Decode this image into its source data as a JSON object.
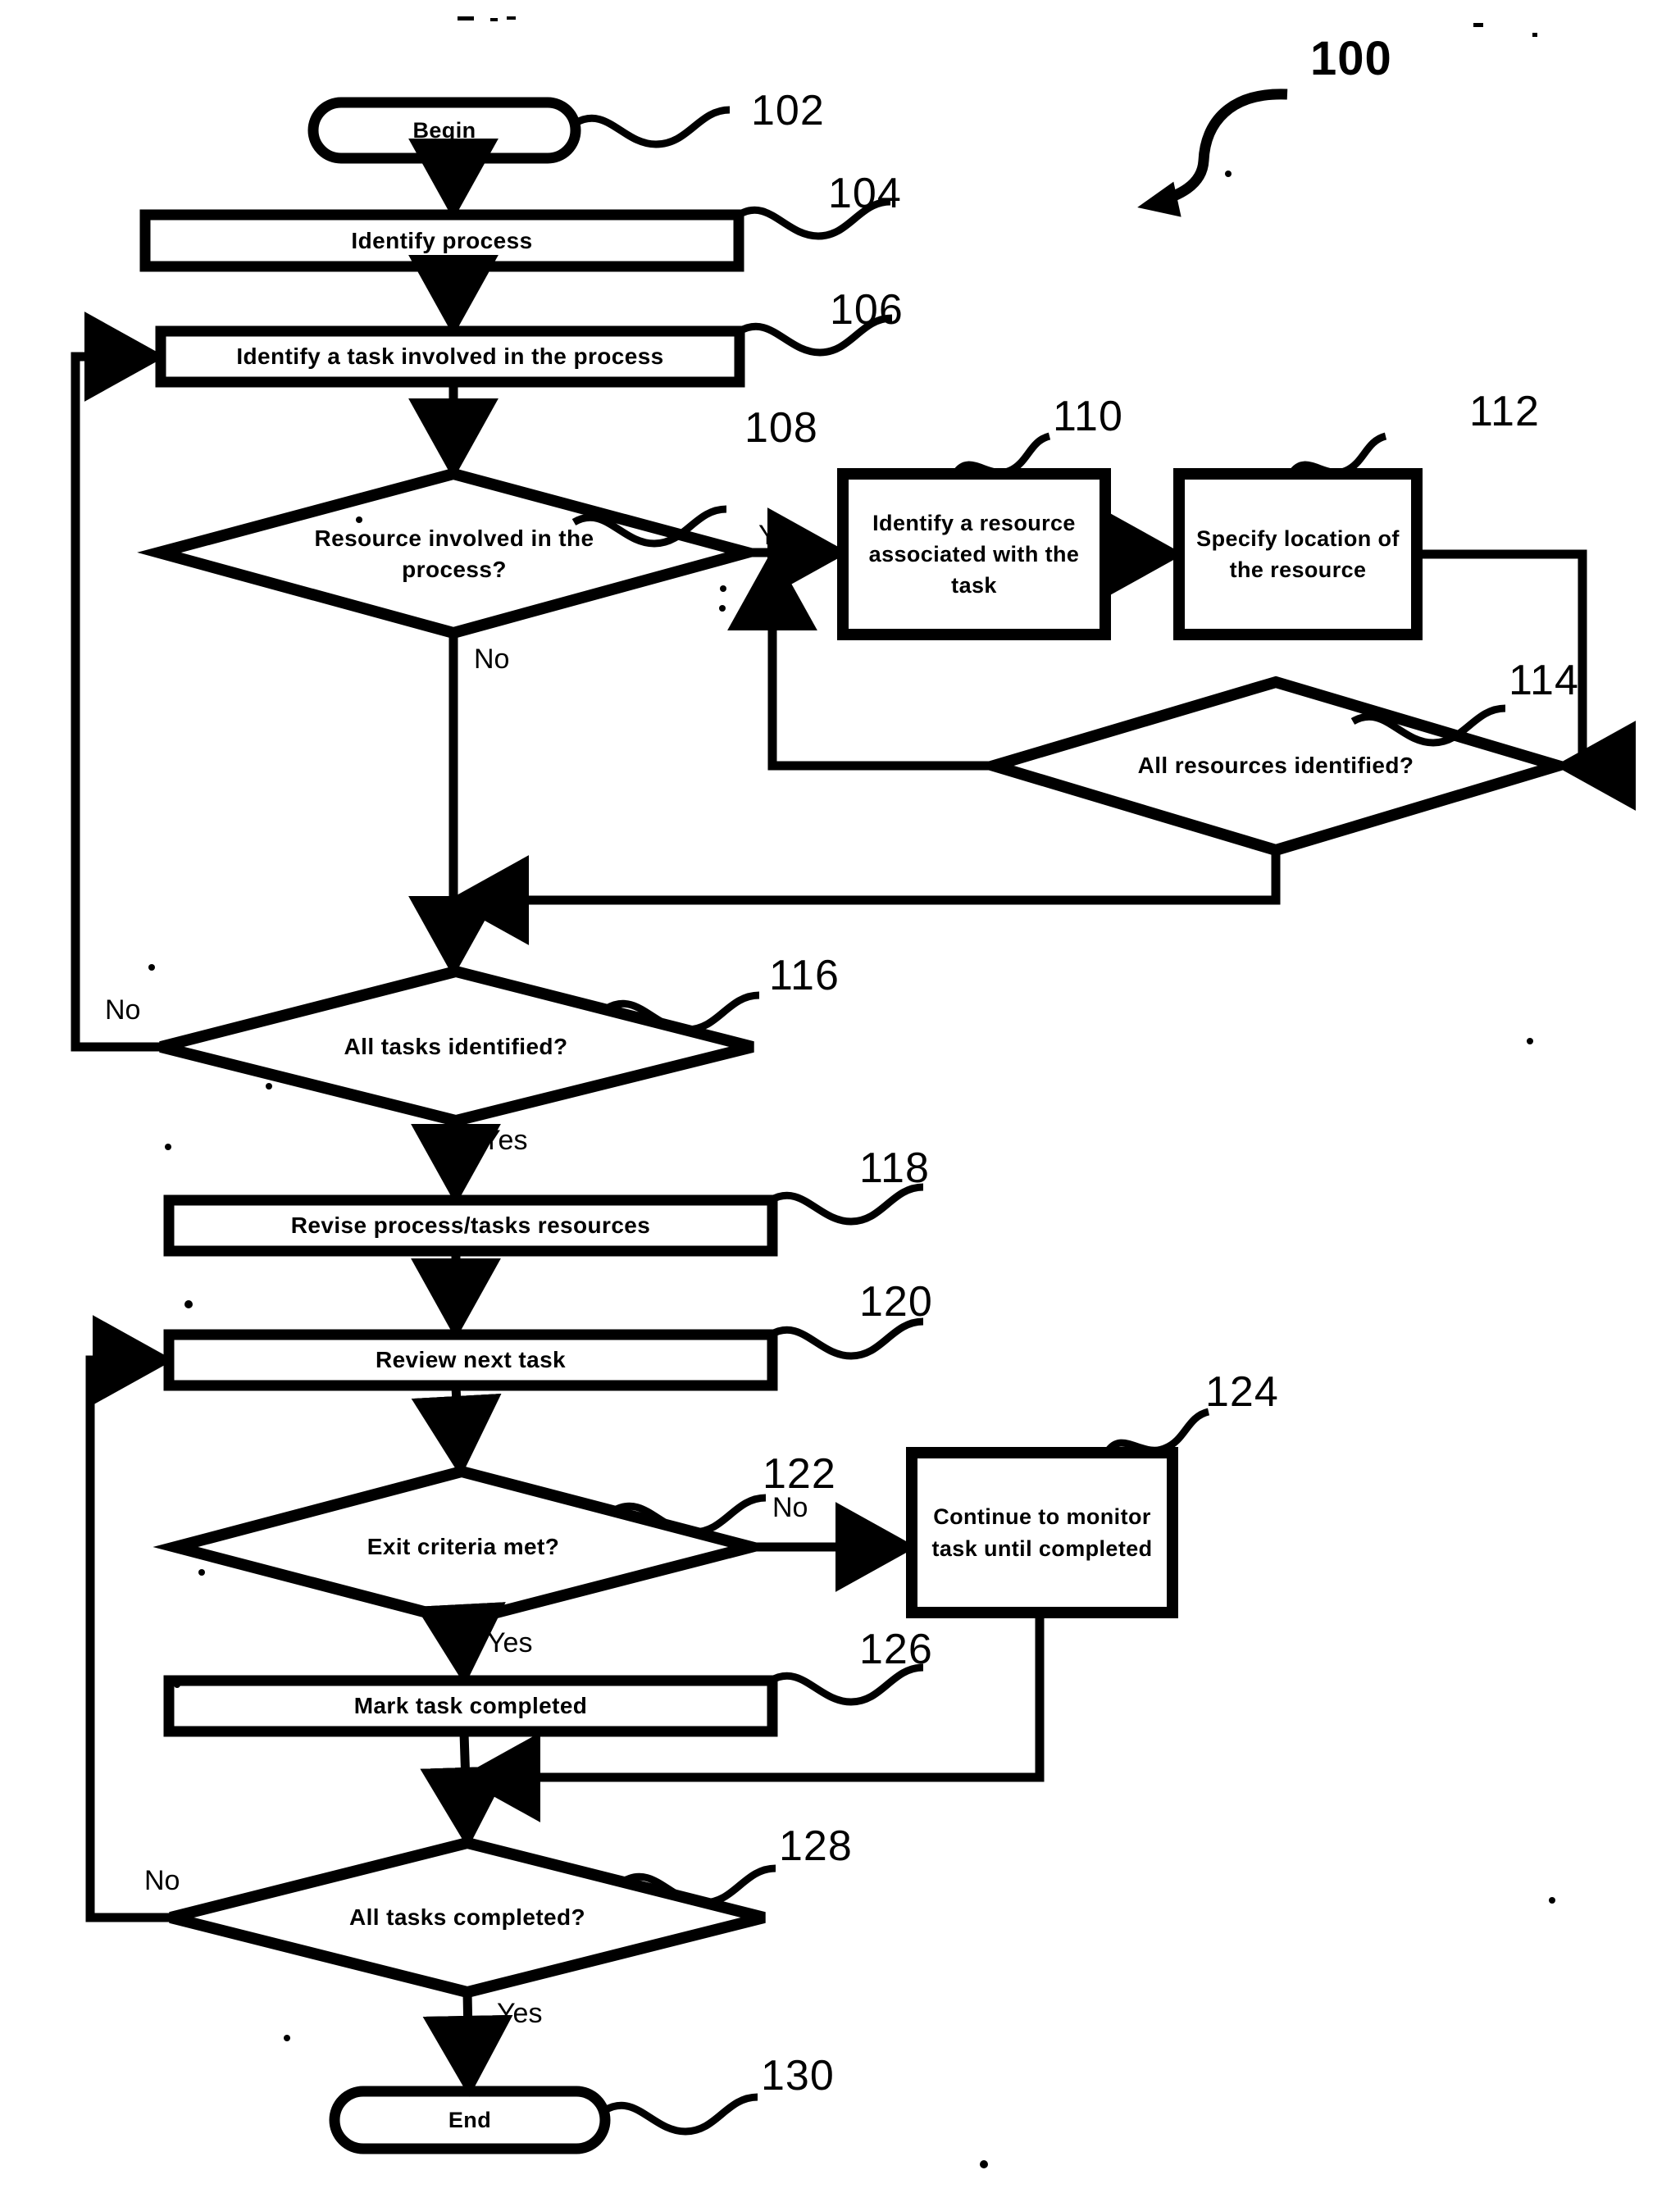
{
  "figure": {
    "number": "100",
    "kind": "flowchart"
  },
  "nodes": [
    {
      "id": "n102",
      "ref": "102",
      "shape": "terminal",
      "text": "Begin"
    },
    {
      "id": "n104",
      "ref": "104",
      "shape": "process",
      "text": "Identify process"
    },
    {
      "id": "n106",
      "ref": "106",
      "shape": "process",
      "text": "Identify a task involved in the process"
    },
    {
      "id": "n108",
      "ref": "108",
      "shape": "decision",
      "text": "Resource involved in the process?"
    },
    {
      "id": "n110",
      "ref": "110",
      "shape": "process",
      "text": "Identify a resource associated with the task"
    },
    {
      "id": "n112",
      "ref": "112",
      "shape": "process",
      "text": "Specify location of the resource"
    },
    {
      "id": "n114",
      "ref": "114",
      "shape": "decision",
      "text": "All resources identified?"
    },
    {
      "id": "n116",
      "ref": "116",
      "shape": "decision",
      "text": "All tasks identified?"
    },
    {
      "id": "n118",
      "ref": "118",
      "shape": "process",
      "text": "Revise process/tasks resources"
    },
    {
      "id": "n120",
      "ref": "120",
      "shape": "process",
      "text": "Review next task"
    },
    {
      "id": "n122",
      "ref": "122",
      "shape": "decision",
      "text": "Exit criteria met?"
    },
    {
      "id": "n124",
      "ref": "124",
      "shape": "process",
      "text": "Continue to monitor task until completed"
    },
    {
      "id": "n126",
      "ref": "126",
      "shape": "process",
      "text": "Mark task completed"
    },
    {
      "id": "n128",
      "ref": "128",
      "shape": "decision",
      "text": "All tasks completed?"
    },
    {
      "id": "n130",
      "ref": "130",
      "shape": "terminal",
      "text": "End"
    }
  ],
  "edge_labels": {
    "e108_yes": "Yes",
    "e108_no": "No",
    "e116_no": "No",
    "e116_yes": "Yes",
    "e122_no": "No",
    "e122_yes": "Yes",
    "e128_no": "No",
    "e128_yes": "Yes"
  },
  "refs": {
    "r100": "100",
    "r102": "102",
    "r104": "104",
    "r106": "106",
    "r108": "108",
    "r110": "110",
    "r112": "112",
    "r114": "114",
    "r116": "116",
    "r118": "118",
    "r120": "120",
    "r122": "122",
    "r124": "124",
    "r126": "126",
    "r128": "128",
    "r130": "130"
  },
  "style": {
    "ink": "#000000",
    "paper": "#ffffff"
  }
}
